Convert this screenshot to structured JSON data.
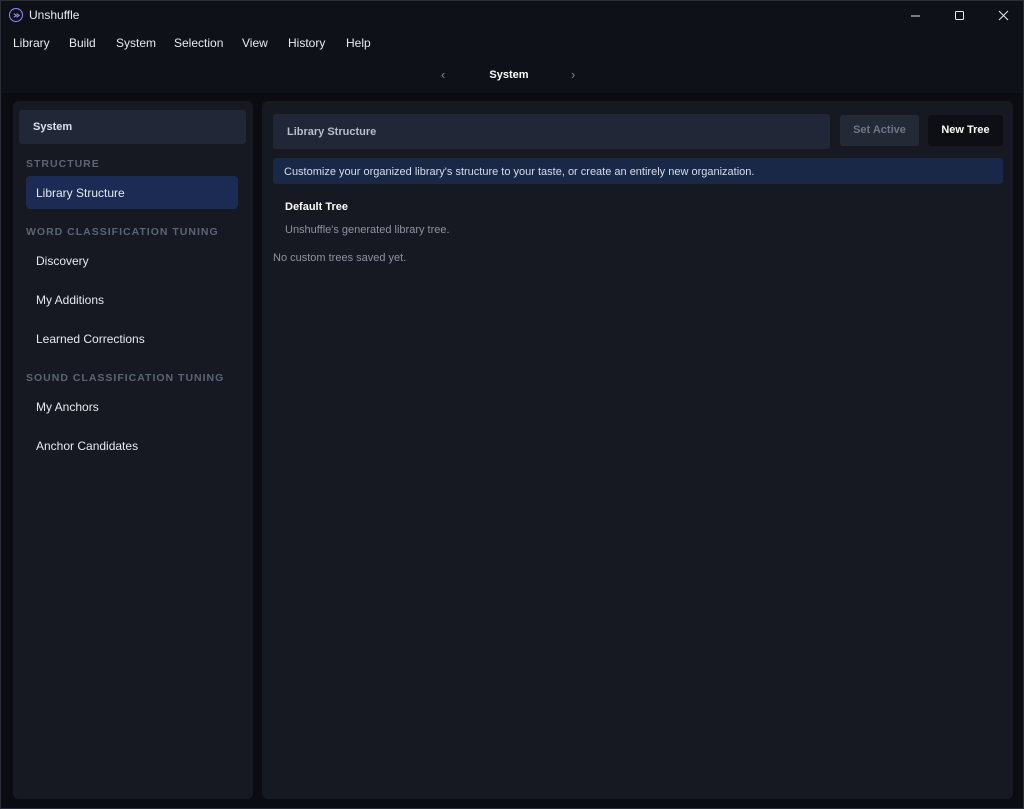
{
  "window": {
    "title": "Unshuffle",
    "controls": [
      "minimize-icon",
      "maximize-icon",
      "close-icon"
    ]
  },
  "menu": [
    "Library",
    "Build",
    "System",
    "Selection",
    "View",
    "History",
    "Help"
  ],
  "nav": {
    "title": "System",
    "prev": "‹",
    "next": "›"
  },
  "sidebar": {
    "header": "System",
    "sections": [
      {
        "label": "STRUCTURE",
        "items": [
          {
            "label": "Library Structure",
            "active": true
          }
        ]
      },
      {
        "label": "WORD CLASSIFICATION TUNING",
        "items": [
          {
            "label": "Discovery"
          },
          {
            "label": "My Additions"
          },
          {
            "label": "Learned Corrections"
          }
        ]
      },
      {
        "label": "SOUND CLASSIFICATION TUNING",
        "items": [
          {
            "label": "My Anchors"
          },
          {
            "label": "Anchor Candidates"
          }
        ]
      }
    ]
  },
  "main": {
    "select_value": "Library Structure",
    "set_active_label": "Set Active",
    "new_tree_label": "New Tree",
    "info": "Customize your organized library's structure to your taste, or create an entirely new organization.",
    "default_tree": {
      "name": "Default Tree",
      "description": "Unshuffle's generated library tree."
    },
    "empty_message": "No custom trees saved yet."
  },
  "colors": {
    "accent": "#1b2b54",
    "banner": "#192846",
    "panel": "#161922"
  }
}
